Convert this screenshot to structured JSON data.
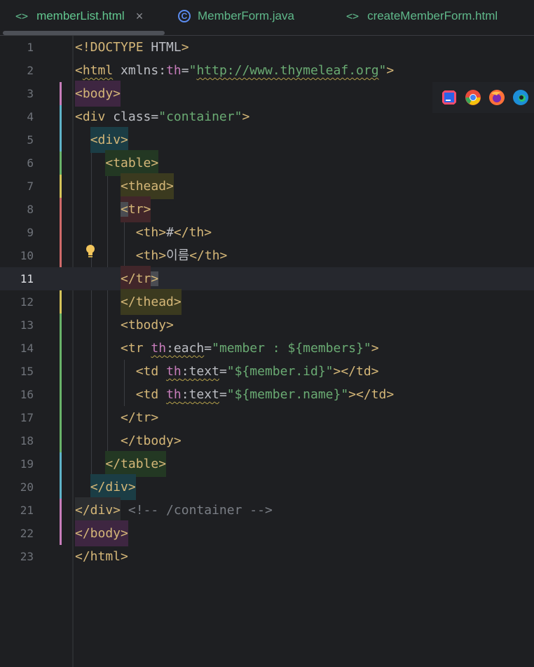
{
  "tabs": [
    {
      "label": "memberList.html",
      "icon": "html-file-icon",
      "active": true,
      "close": "×"
    },
    {
      "label": "MemberForm.java",
      "icon": "java-class-icon",
      "active": false
    },
    {
      "label": "createMemberForm.html",
      "icon": "html-file-icon",
      "active": false
    }
  ],
  "editor": {
    "current_line": 11,
    "line_numbers": [
      "1",
      "2",
      "3",
      "4",
      "5",
      "6",
      "7",
      "8",
      "9",
      "10",
      "11",
      "12",
      "13",
      "14",
      "15",
      "16",
      "17",
      "18",
      "19",
      "20",
      "21",
      "22",
      "23"
    ],
    "lines": [
      "<!DOCTYPE HTML>",
      "<html xmlns:th=\"http://www.thymeleaf.org\">",
      "<body>",
      "<div class=\"container\">",
      "  <div>",
      "    <table>",
      "      <thead>",
      "      <tr>",
      "        <th>#</th>",
      "        <th>이름</th>",
      "      </tr>",
      "      </thead>",
      "      <tbody>",
      "      <tr th:each=\"member : ${members}\">",
      "        <td th:text=\"${member.id}\"></td>",
      "        <td th:text=\"${member.name}\"></td>",
      "      </tr>",
      "      </tbody>",
      "    </table>",
      "  </div>",
      "</div> <!-- /container -->",
      "</body>",
      "</html>"
    ]
  },
  "browser_icons": [
    "intellij-icon",
    "chrome-icon",
    "firefox-icon",
    "edge-icon"
  ],
  "colors": {
    "background": "#1e1f22",
    "tag": "#d5b778",
    "string": "#6aab73",
    "namespace": "#c77dbb",
    "comment": "#7a7e85",
    "tab_label": "#5fb88a"
  }
}
